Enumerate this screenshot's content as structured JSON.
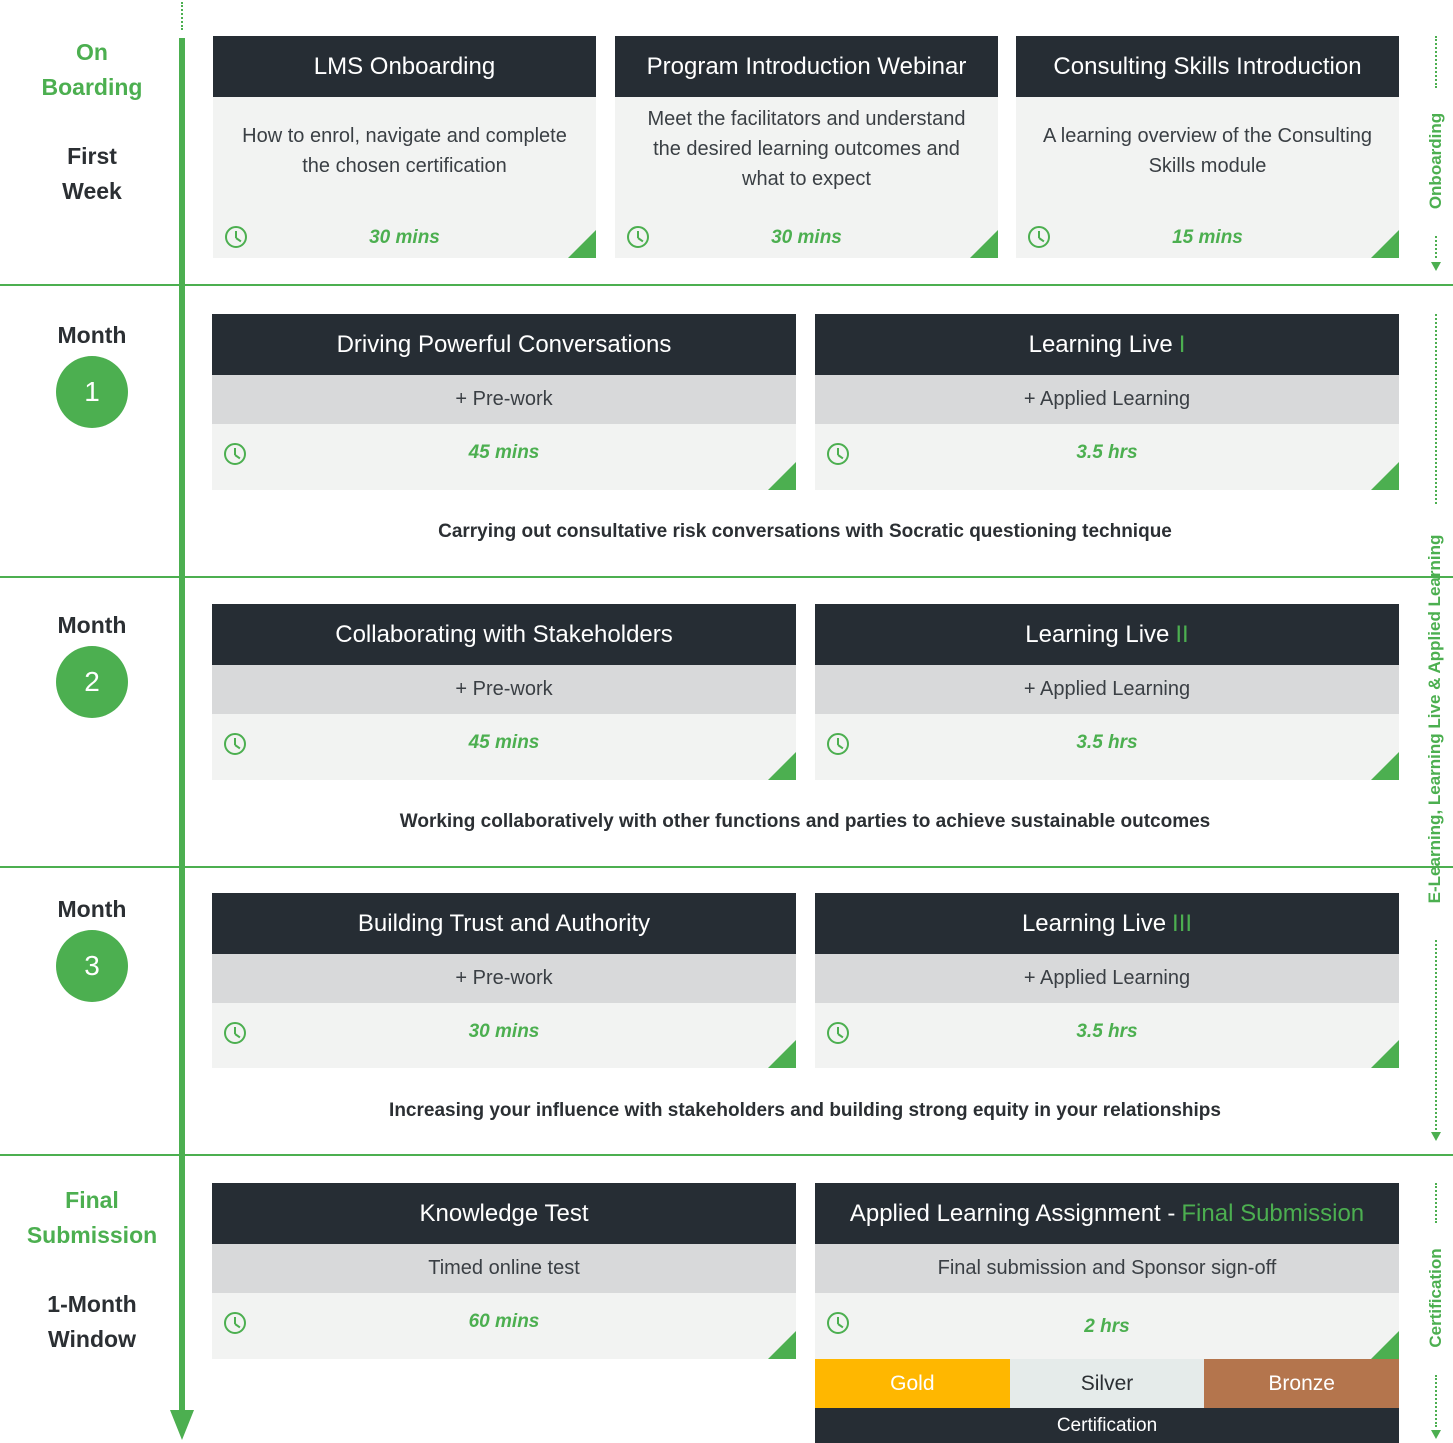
{
  "colors": {
    "accent": "#4caf50",
    "dark": "#262d34",
    "panel": "#f2f3f2",
    "subpanel": "#d8d9da",
    "gold": "#ffb700",
    "silver": "#e5ebea",
    "bronze": "#b4754d"
  },
  "icons": {
    "duration": "clock-icon",
    "corner": "corner-triangle"
  },
  "rows": {
    "onboarding": {
      "label_green": [
        "On",
        "Boarding"
      ],
      "label_dark": [
        "First",
        "Week"
      ],
      "cards": [
        {
          "title": "LMS Onboarding",
          "desc": "How to enrol, navigate and complete the chosen certification",
          "duration": "30 mins"
        },
        {
          "title": "Program Introduction Webinar",
          "desc": "Meet the facilitators and understand the desired learning outcomes and what to expect",
          "duration": "30 mins"
        },
        {
          "title": "Consulting Skills Introduction",
          "desc": "A learning overview of the Consulting Skills module",
          "duration": "15 mins"
        }
      ]
    },
    "month1": {
      "label": "Month",
      "number": "1",
      "cards": [
        {
          "title": "Driving Powerful Conversations",
          "title_accent": "",
          "sub": "+ Pre-work",
          "duration": "45 mins"
        },
        {
          "title": "Learning Live ",
          "title_accent": "I",
          "sub": "+ Applied Learning",
          "duration": "3.5 hrs"
        }
      ],
      "summary": "Carrying out consultative risk conversations with Socratic questioning technique"
    },
    "month2": {
      "label": "Month",
      "number": "2",
      "cards": [
        {
          "title": "Collaborating with Stakeholders",
          "title_accent": "",
          "sub": "+ Pre-work",
          "duration": "45 mins"
        },
        {
          "title": "Learning Live ",
          "title_accent": "II",
          "sub": "+ Applied Learning",
          "duration": "3.5 hrs"
        }
      ],
      "summary": "Working collaboratively with other functions and parties to achieve sustainable outcomes"
    },
    "month3": {
      "label": "Month",
      "number": "3",
      "cards": [
        {
          "title": "Building Trust and Authority",
          "title_accent": "",
          "sub": "+ Pre-work",
          "duration": "30 mins"
        },
        {
          "title": "Learning Live ",
          "title_accent": "III",
          "sub": "+ Applied Learning",
          "duration": "3.5 hrs"
        }
      ],
      "summary": "Increasing your influence with stakeholders and building strong equity in your relationships"
    },
    "final": {
      "label_green": [
        "Final",
        "Submission"
      ],
      "label_dark": [
        "1-Month",
        "Window"
      ],
      "cards": [
        {
          "title": "Knowledge Test",
          "title_accent": "",
          "sub": "Timed online test",
          "duration": "60 mins"
        },
        {
          "title": "Applied Learning Assignment - ",
          "title_accent": "Final Submission",
          "sub": "Final submission and Sponsor sign-off",
          "duration": "2 hrs"
        }
      ],
      "tiers": [
        "Gold",
        "Silver",
        "Bronze"
      ],
      "certification": "Certification"
    }
  },
  "side_labels": {
    "onboarding": "Onboarding",
    "learning": "E-Learning, Learning Live & Applied Learning",
    "certification": "Certification"
  }
}
